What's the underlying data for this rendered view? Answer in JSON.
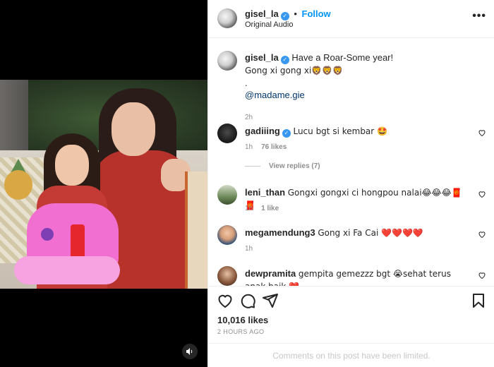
{
  "media": {
    "mute_icon": "speaker-muted-icon"
  },
  "header": {
    "username": "gisel_la",
    "follow_label": "Follow",
    "separator": "•",
    "subtitle": "Original Audio",
    "more_label": "•••"
  },
  "caption": {
    "username": "gisel_la",
    "line1": "Have a Roar-Some year!",
    "line2": "Gong xi gong xi🦁🦁🦁",
    "line3": ".",
    "mention": "@madame.gie",
    "time": "2h"
  },
  "comments": [
    {
      "username": "gadiiing",
      "verified": true,
      "text": "Lucu bgt si kembar 🤩",
      "time": "1h",
      "likes": "76 likes",
      "replies": "View replies (7)"
    },
    {
      "username": "leni_than",
      "verified": false,
      "text": "Gongxi gongxi ci hongpou nalai😂😂😂🧧🧧",
      "time": "1h",
      "likes": "1 like"
    },
    {
      "username": "megamendung3",
      "verified": false,
      "text": "Gong xi Fa Cai ❤️❤️❤️❤️",
      "time": "1h",
      "likes": ""
    },
    {
      "username": "dewpramita",
      "verified": false,
      "text": "gempita gemezzz bgt 😭sehat terus anak baik ❤️",
      "time": "",
      "likes": ""
    }
  ],
  "actions": {
    "like_icon": "heart-icon",
    "comment_icon": "comment-icon",
    "share_icon": "paper-plane-icon",
    "save_icon": "bookmark-icon",
    "likes_count": "10,016 likes",
    "time_ago": "2 HOURS AGO",
    "limited_notice": "Comments on this post have been limited."
  },
  "colors": {
    "accent": "#0095f6",
    "verified": "#3897f0",
    "muted": "#8e8e8e",
    "heart": "#e0245e"
  }
}
